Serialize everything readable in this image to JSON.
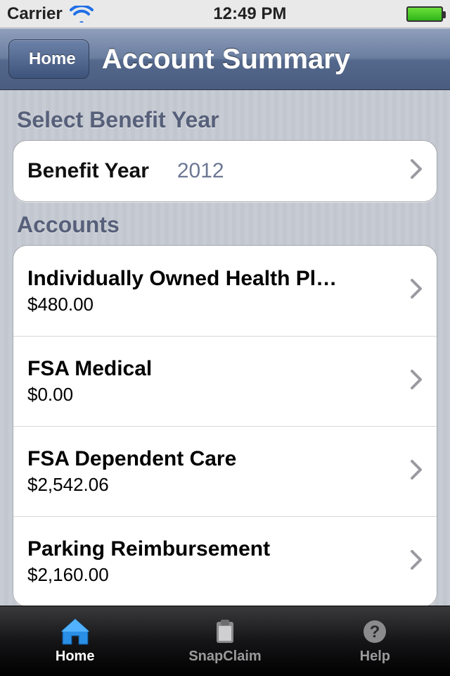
{
  "status": {
    "carrier": "Carrier",
    "time": "12:49 PM"
  },
  "nav": {
    "back_label": "Home",
    "title": "Account Summary"
  },
  "sections": {
    "select_year_header": "Select Benefit Year",
    "accounts_header": "Accounts"
  },
  "benefit_year": {
    "label": "Benefit Year",
    "value": "2012"
  },
  "accounts": [
    {
      "name": "Individually Owned Health Pl…",
      "amount": "$480.00"
    },
    {
      "name": "FSA Medical",
      "amount": "$0.00"
    },
    {
      "name": "FSA Dependent Care",
      "amount": "$2,542.06"
    },
    {
      "name": "Parking Reimbursement",
      "amount": "$2,160.00"
    }
  ],
  "tabs": {
    "home": "Home",
    "snapclaim": "SnapClaim",
    "help": "Help"
  }
}
